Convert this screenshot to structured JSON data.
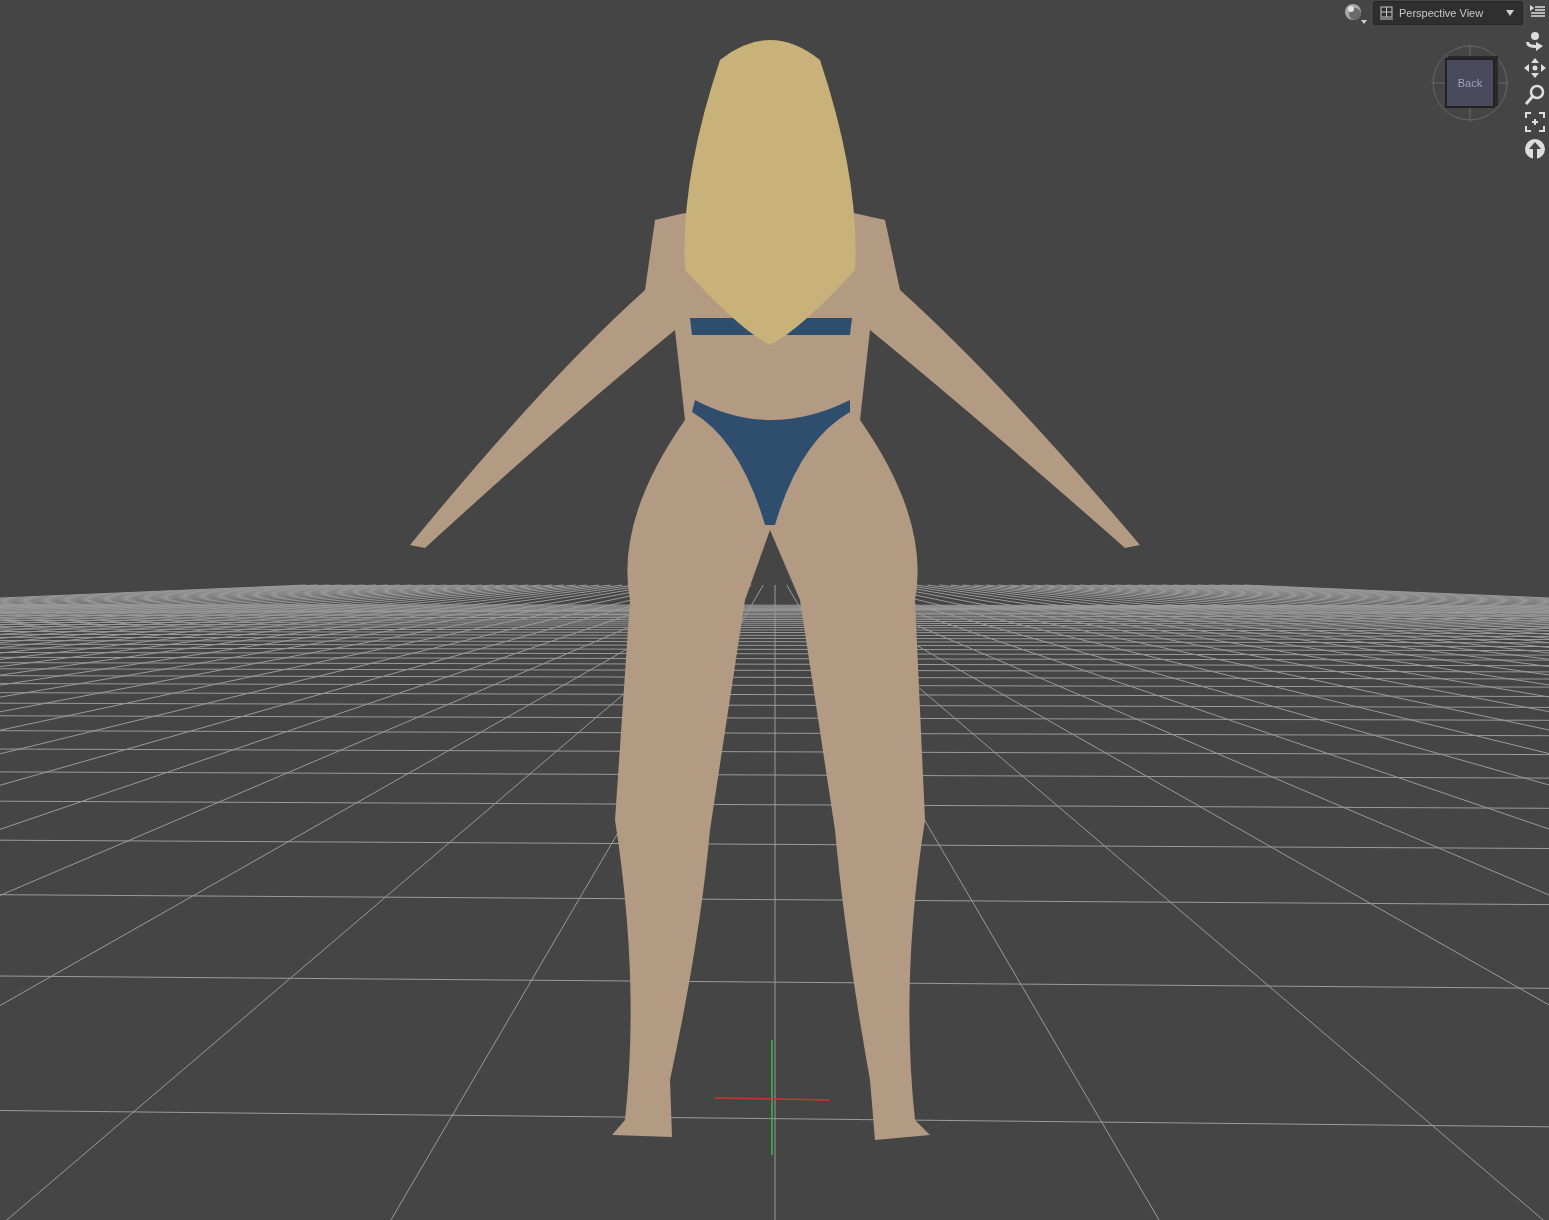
{
  "viewport": {
    "shading_menu": {
      "kind": "sphere"
    },
    "view_menu": {
      "label": "Perspective View"
    },
    "view_cube": {
      "face_label": "Back"
    },
    "tools": [
      {
        "kind": "orbit"
      },
      {
        "kind": "pan"
      },
      {
        "kind": "zoom"
      },
      {
        "kind": "frame"
      },
      {
        "kind": "up"
      }
    ]
  }
}
